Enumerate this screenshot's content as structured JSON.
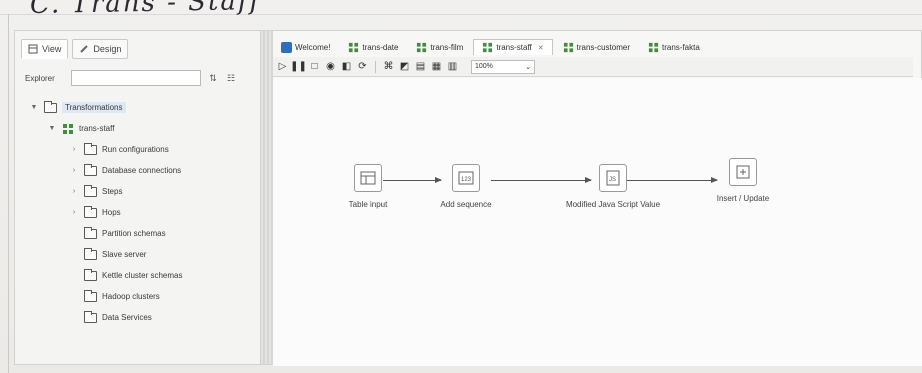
{
  "handwritten_title": "C. Trans - Staff",
  "left_pane": {
    "view_tab": "View",
    "design_tab": "Design",
    "explorer_label": "Explorer",
    "explorer_placeholder": "",
    "tree": {
      "root": "Transformations",
      "transformation": "trans-staff",
      "children": [
        {
          "label": "Run configurations",
          "expandable": true
        },
        {
          "label": "Database connections",
          "expandable": true
        },
        {
          "label": "Steps",
          "expandable": true
        },
        {
          "label": "Hops",
          "expandable": true
        },
        {
          "label": "Partition schemas",
          "expandable": false
        },
        {
          "label": "Slave server",
          "expandable": false
        },
        {
          "label": "Kettle cluster schemas",
          "expandable": false
        },
        {
          "label": "Hadoop clusters",
          "expandable": false
        },
        {
          "label": "Data Services",
          "expandable": false
        }
      ]
    }
  },
  "tabs": [
    {
      "label": "Welcome!",
      "icon": "welcome-icon",
      "active": false
    },
    {
      "label": "trans-date",
      "icon": "transformation-icon",
      "active": false
    },
    {
      "label": "trans-film",
      "icon": "transformation-icon",
      "active": false
    },
    {
      "label": "trans-staff",
      "icon": "transformation-icon",
      "active": true
    },
    {
      "label": "trans-customer",
      "icon": "transformation-icon",
      "active": false
    },
    {
      "label": "trans-fakta",
      "icon": "transformation-icon",
      "active": false
    }
  ],
  "toolbar": {
    "zoom": "100%",
    "buttons": [
      "run-icon",
      "pause-icon",
      "stop-icon",
      "preview-icon",
      "debug-icon",
      "replay-icon",
      "verify-icon",
      "impact-icon",
      "sql-icon",
      "explore-db-icon",
      "layout-icon"
    ]
  },
  "canvas": {
    "steps": [
      {
        "label": "Table input",
        "icon": "table-input-icon"
      },
      {
        "label": "Add sequence",
        "icon": "add-sequence-icon"
      },
      {
        "label": "Modified Java Script Value",
        "icon": "javascript-icon"
      },
      {
        "label": "Insert / Update",
        "icon": "insert-update-icon"
      }
    ]
  },
  "colors": {
    "accent": "#2f6eb8",
    "transformation_icon": "#3f8f3a"
  }
}
